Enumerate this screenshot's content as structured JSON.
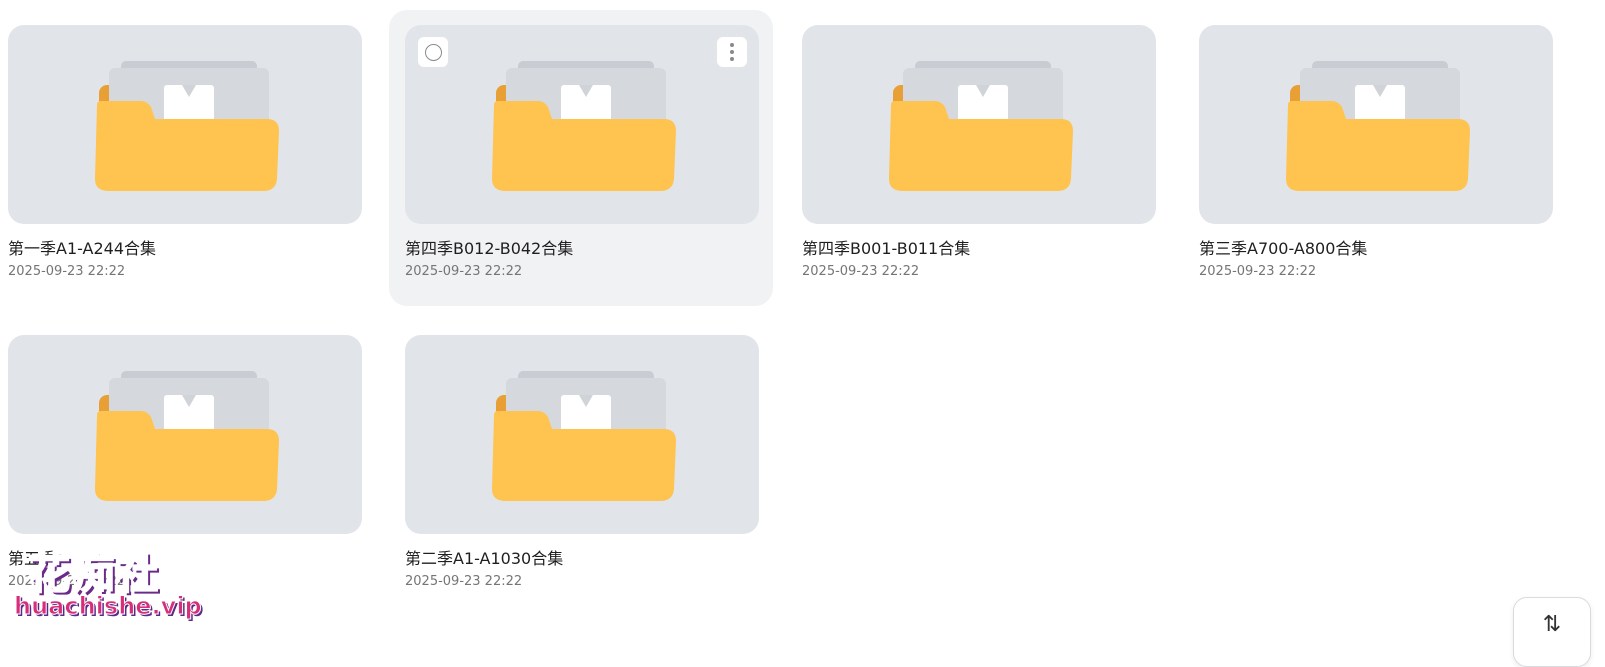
{
  "folders": [
    {
      "title": "第一季A1-A244合集",
      "date": "2025-09-23 22:22",
      "hovered": false
    },
    {
      "title": "第四季B012-B042合集",
      "date": "2025-09-23 22:22",
      "hovered": true
    },
    {
      "title": "第四季B001-B011合集",
      "date": "2025-09-23 22:22",
      "hovered": false
    },
    {
      "title": "第三季A700-A800合集",
      "date": "2025-09-23 22:22",
      "hovered": false
    },
    {
      "title": "第五季",
      "date": "2025-09-23 22:22",
      "hovered": false
    },
    {
      "title": "第二季A1-A1030合集",
      "date": "2025-09-23 22:22",
      "hovered": false
    }
  ],
  "watermark": {
    "name": "花痴社",
    "domain": "huachishe.vip"
  },
  "sort_button": {
    "icon": "sort-icon",
    "glyph": "⇅"
  },
  "colors": {
    "thumb_bg": "#e1e5e9",
    "hover_bg": "#f1f2f4",
    "folder_front": "#ffc350",
    "folder_back": "#e8a036",
    "paper": "#d5d9de"
  }
}
